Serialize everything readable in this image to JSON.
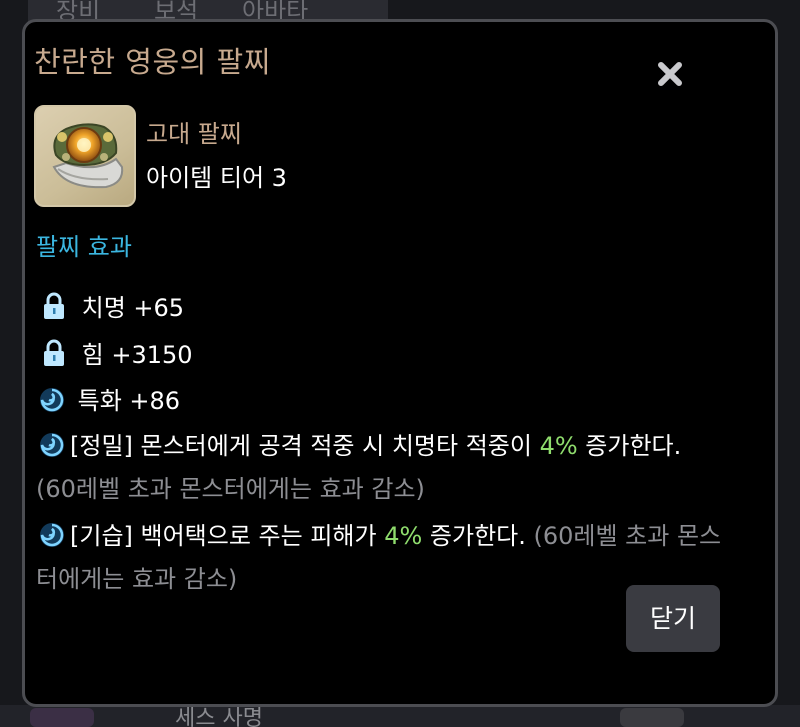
{
  "background": {
    "tabs": [
      "장비",
      "보석",
      "아바타"
    ],
    "bottom_text": "세스 사명"
  },
  "dialog": {
    "title": "찬란한 영웅의 팔찌",
    "close_icon": "close-x-icon",
    "item": {
      "icon": "ancient-bracelet-icon",
      "grade": "고대 팔찌",
      "tier": "아이템 티어 3"
    },
    "effects": {
      "title": "팔찌 효과",
      "rows": [
        {
          "icon": "lock-icon",
          "text": "치명 +65"
        },
        {
          "icon": "lock-icon",
          "text": "힘 +3150"
        },
        {
          "icon": "swirl-icon",
          "text": "특화 +86"
        },
        {
          "icon": "swirl-icon",
          "prefix": "[정밀] 몬스터에게 공격 적중 시 치명타 적중이 ",
          "highlight": "4%",
          "suffix": " 증가한다.",
          "note": " (60레벨 초과 몬스터에게는 효과 감소)"
        },
        {
          "icon": "swirl-icon",
          "prefix": "[기습] 백어택으로 주는 피해가 ",
          "highlight": "4%",
          "suffix": " 증가한다.",
          "note": " (60레벨 초과 몬스터에게는 효과 감소)"
        }
      ]
    },
    "close_button": "닫기"
  },
  "colors": {
    "title": "#c7a98e",
    "section": "#3bb6e0",
    "highlight": "#8fdc6d",
    "dim": "#8d8e93"
  }
}
